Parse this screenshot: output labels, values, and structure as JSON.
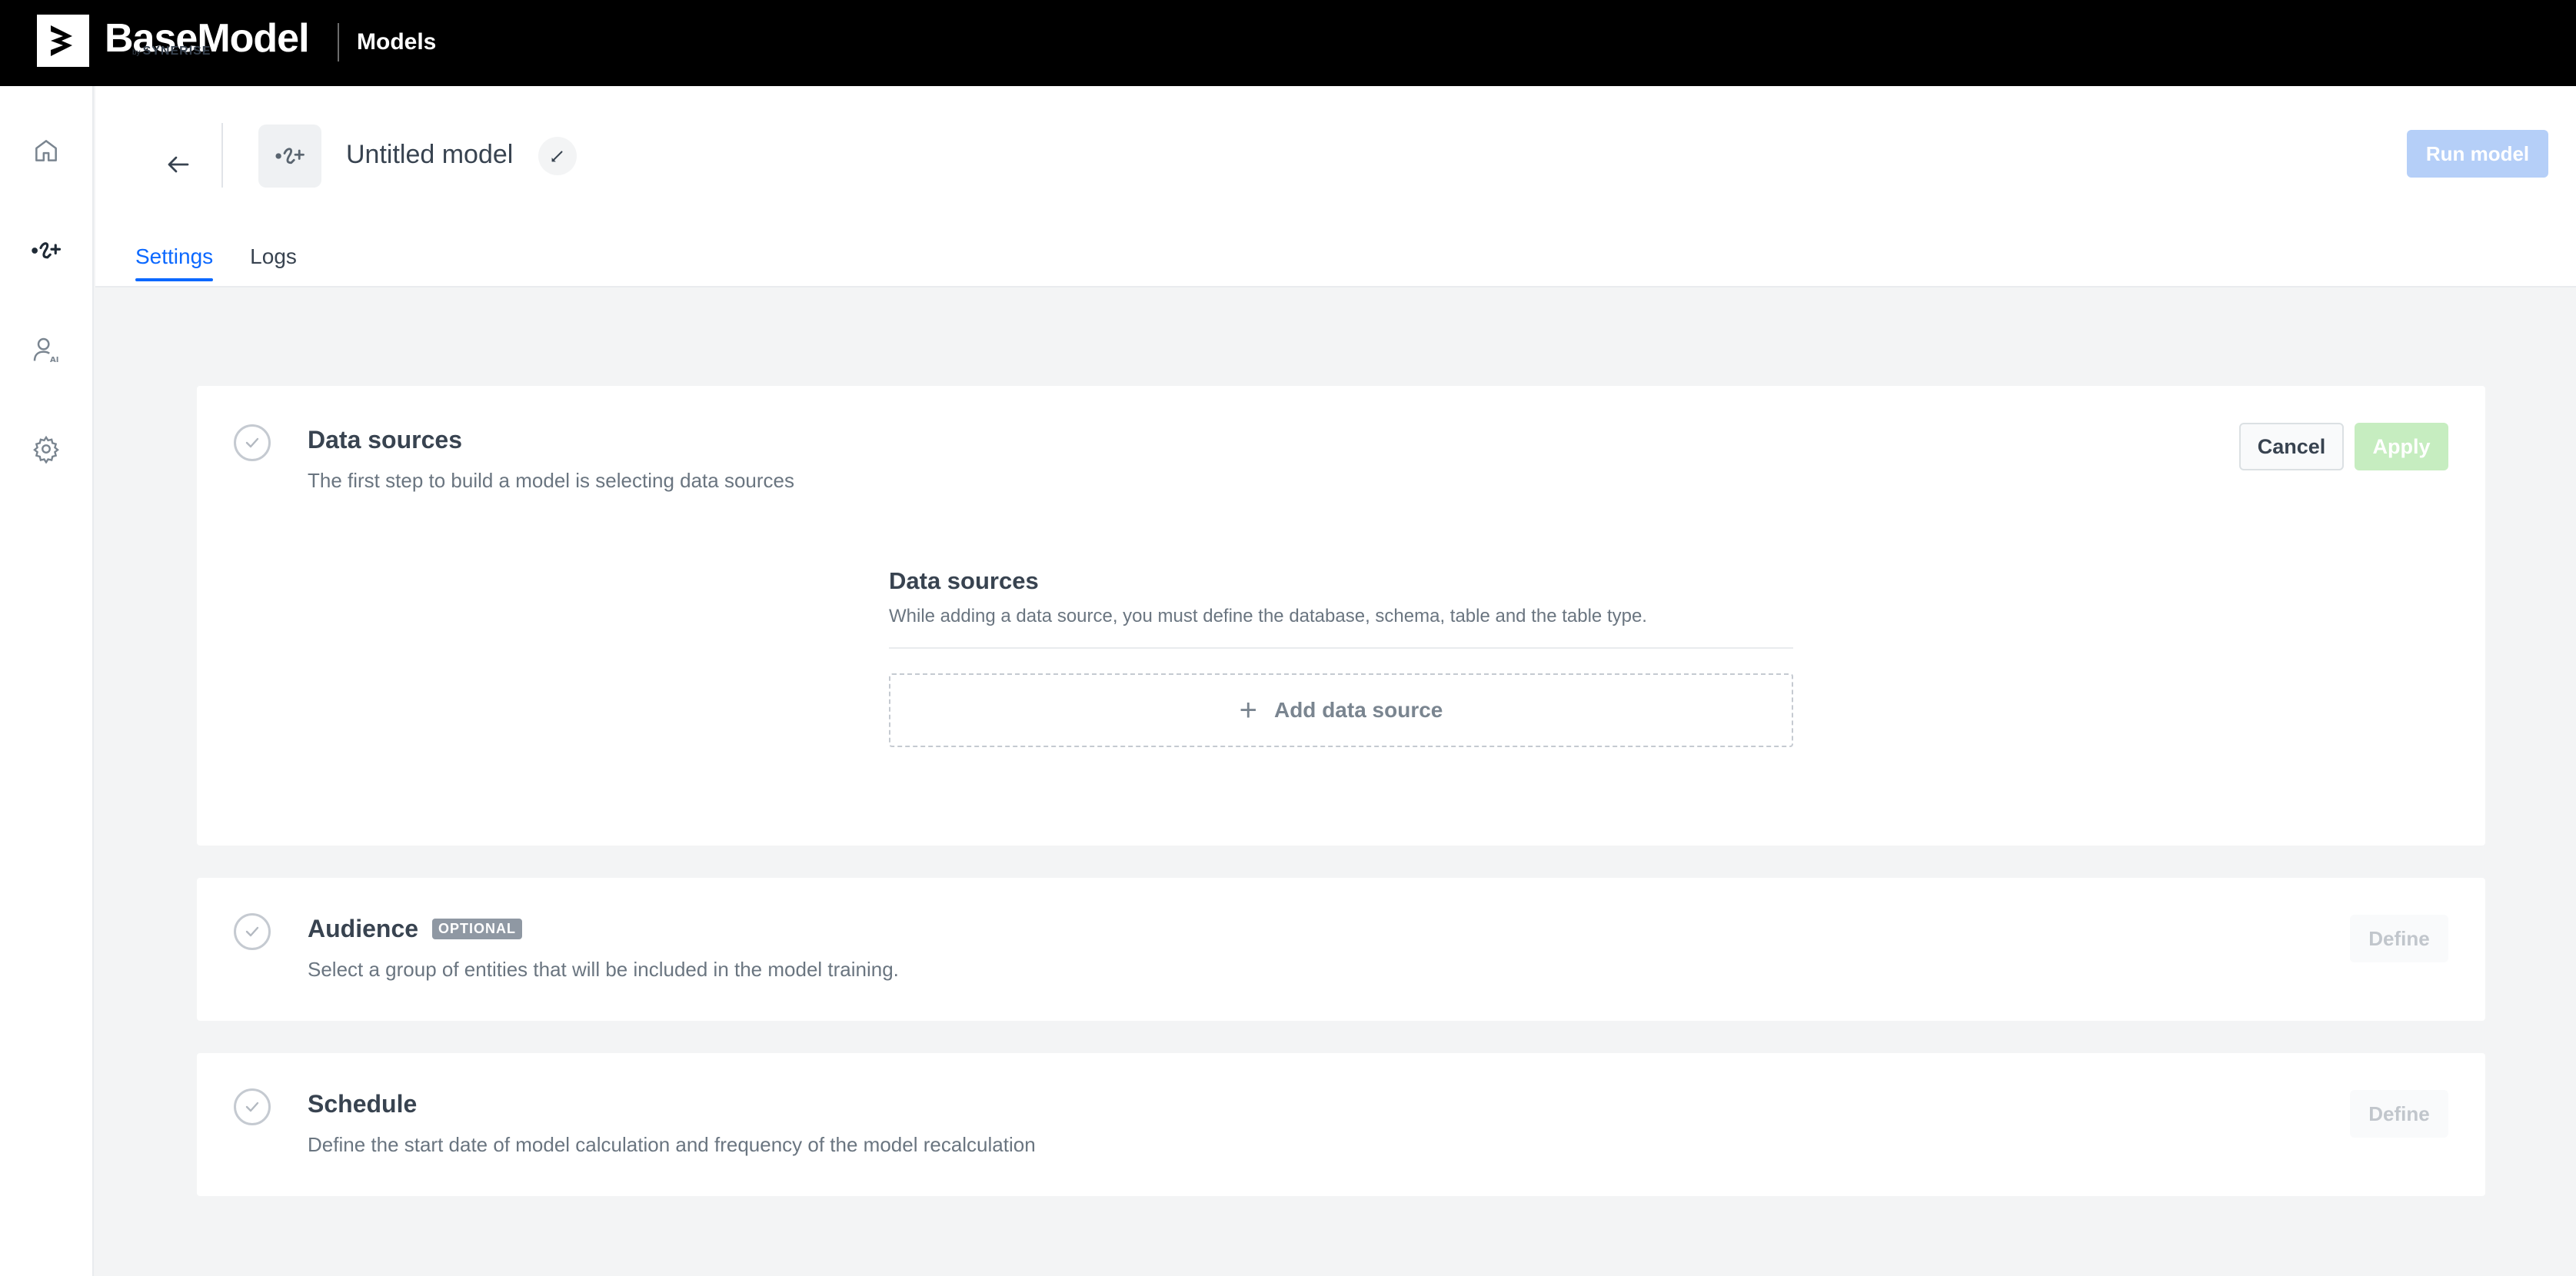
{
  "topbar": {
    "brand_name": "BaseModel",
    "brand_by": "by",
    "brand_company": "SYNERISE",
    "section": "Models"
  },
  "sidebar": {
    "items": [
      {
        "icon": "home-icon",
        "active": false
      },
      {
        "icon": "models-icon",
        "active": true
      },
      {
        "icon": "user-ai-icon",
        "active": false
      },
      {
        "icon": "gear-icon",
        "active": false
      }
    ]
  },
  "header": {
    "title": "Untitled model",
    "run_label": "Run model",
    "tabs": [
      {
        "label": "Settings",
        "active": true
      },
      {
        "label": "Logs",
        "active": false
      }
    ]
  },
  "steps": {
    "data_sources": {
      "title": "Data sources",
      "description": "The first step to build a model is selecting data sources",
      "cancel_label": "Cancel",
      "apply_label": "Apply",
      "inner_title": "Data sources",
      "inner_description": "While adding a data source, you must define the database, schema, table and the table type.",
      "add_label": "Add data source"
    },
    "audience": {
      "title": "Audience",
      "badge": "OPTIONAL",
      "description": "Select a group of entities that will be included in the model training.",
      "define_label": "Define"
    },
    "schedule": {
      "title": "Schedule",
      "description": "Define the start date of model calculation and frequency of the model recalculation",
      "define_label": "Define"
    }
  },
  "colors": {
    "primary": "#0b68ff",
    "run_disabled": "#b5cff8",
    "apply_disabled": "#c6edc0",
    "topbar": "#000000"
  }
}
